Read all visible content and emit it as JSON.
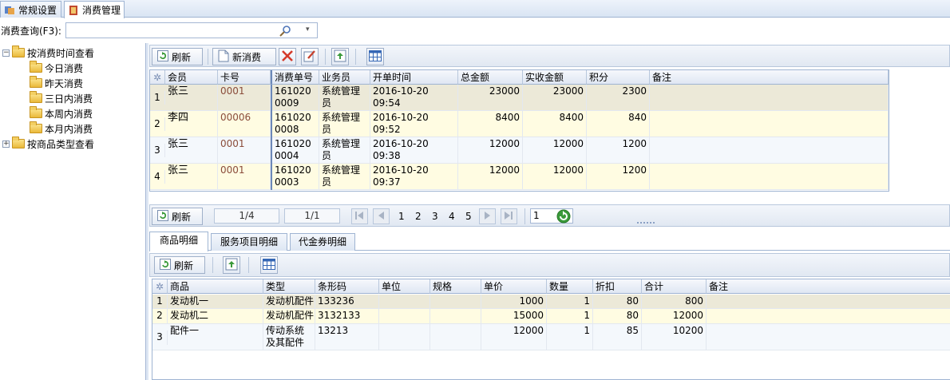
{
  "tabs": [
    {
      "label": "常规设置"
    },
    {
      "label": "消费管理"
    }
  ],
  "search": {
    "label": "消费查询(F3):",
    "value": ""
  },
  "tree": [
    {
      "label": "按消费时间查看",
      "expander": "−"
    },
    {
      "label": "今日消费"
    },
    {
      "label": "昨天消费"
    },
    {
      "label": "三日内消费"
    },
    {
      "label": "本周内消费"
    },
    {
      "label": "本月内消费"
    },
    {
      "label": "按商品类型查看",
      "expander": "+"
    }
  ],
  "toolbar": {
    "refresh": "刷新",
    "new_order": "新消费"
  },
  "orders": {
    "headers": [
      "会员",
      "卡号",
      "消费单号",
      "业务员",
      "开单时间",
      "总金额",
      "实收金额",
      "积分",
      "备注"
    ],
    "rows": [
      {
        "n": "1",
        "member": "张三",
        "card": "0001",
        "order_no": "1610200009",
        "clerk": "系统管理员",
        "time": "2016-10-20 09:54",
        "total": "23000",
        "paid": "23000",
        "points": "2300",
        "note": ""
      },
      {
        "n": "2",
        "member": "李四",
        "card": "00006",
        "order_no": "1610200008",
        "clerk": "系统管理员",
        "time": "2016-10-20 09:52",
        "total": "8400",
        "paid": "8400",
        "points": "840",
        "note": ""
      },
      {
        "n": "3",
        "member": "张三",
        "card": "0001",
        "order_no": "1610200004",
        "clerk": "系统管理员",
        "time": "2016-10-20 09:38",
        "total": "12000",
        "paid": "12000",
        "points": "1200",
        "note": ""
      },
      {
        "n": "4",
        "member": "张三",
        "card": "0001",
        "order_no": "1610200003",
        "clerk": "系统管理员",
        "time": "2016-10-20 09:37",
        "total": "12000",
        "paid": "12000",
        "points": "1200",
        "note": ""
      }
    ]
  },
  "pager": {
    "refresh": "刷新",
    "record": "1/4",
    "page": "1/1",
    "pages": [
      "1",
      "2",
      "3",
      "4",
      "5"
    ],
    "goto": "1"
  },
  "detail_tabs": [
    {
      "label": "商品明细"
    },
    {
      "label": "服务项目明细"
    },
    {
      "label": "代金券明细"
    }
  ],
  "detail_toolbar": {
    "refresh": "刷新"
  },
  "items": {
    "headers": [
      "商品",
      "类型",
      "条形码",
      "单位",
      "规格",
      "单价",
      "数量",
      "折扣",
      "合计",
      "备注"
    ],
    "rows": [
      {
        "n": "1",
        "name": "发动机一",
        "type": "发动机配件",
        "barcode": "133236",
        "unit": "",
        "spec": "",
        "price": "1000",
        "qty": "1",
        "disc": "80",
        "sum": "800",
        "note": ""
      },
      {
        "n": "2",
        "name": "发动机二",
        "type": "发动机配件",
        "barcode": "3132133",
        "unit": "",
        "spec": "",
        "price": "15000",
        "qty": "1",
        "disc": "80",
        "sum": "12000",
        "note": ""
      },
      {
        "n": "3",
        "name": "配件一",
        "type": "传动系统及其配件",
        "barcode": "13213",
        "unit": "",
        "spec": "",
        "price": "12000",
        "qty": "1",
        "disc": "85",
        "sum": "10200",
        "note": ""
      }
    ]
  },
  "colors": {
    "row_selected": "#ece9d8",
    "row_alt": "#fffce2",
    "row_even": "#f4f8fc",
    "header_bg": "#dfe7f3",
    "refresh_green": "#3a9a3a"
  }
}
